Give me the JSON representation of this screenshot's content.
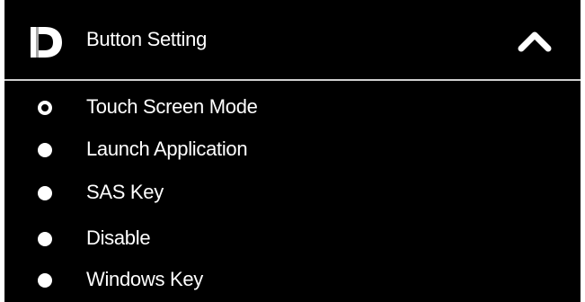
{
  "panel": {
    "title": "Button Setting",
    "logo_icon": "d-logo-icon",
    "collapse_icon": "chevron-up-icon",
    "expanded": true
  },
  "options": [
    {
      "label": "Touch Screen Mode",
      "selected": true
    },
    {
      "label": "Launch Application",
      "selected": false
    },
    {
      "label": "SAS Key",
      "selected": false
    },
    {
      "label": "Disable",
      "selected": false
    },
    {
      "label": "Windows Key",
      "selected": false
    }
  ],
  "colors": {
    "background": "#000000",
    "text": "#ffffff",
    "divider": "#cfcfcf"
  }
}
